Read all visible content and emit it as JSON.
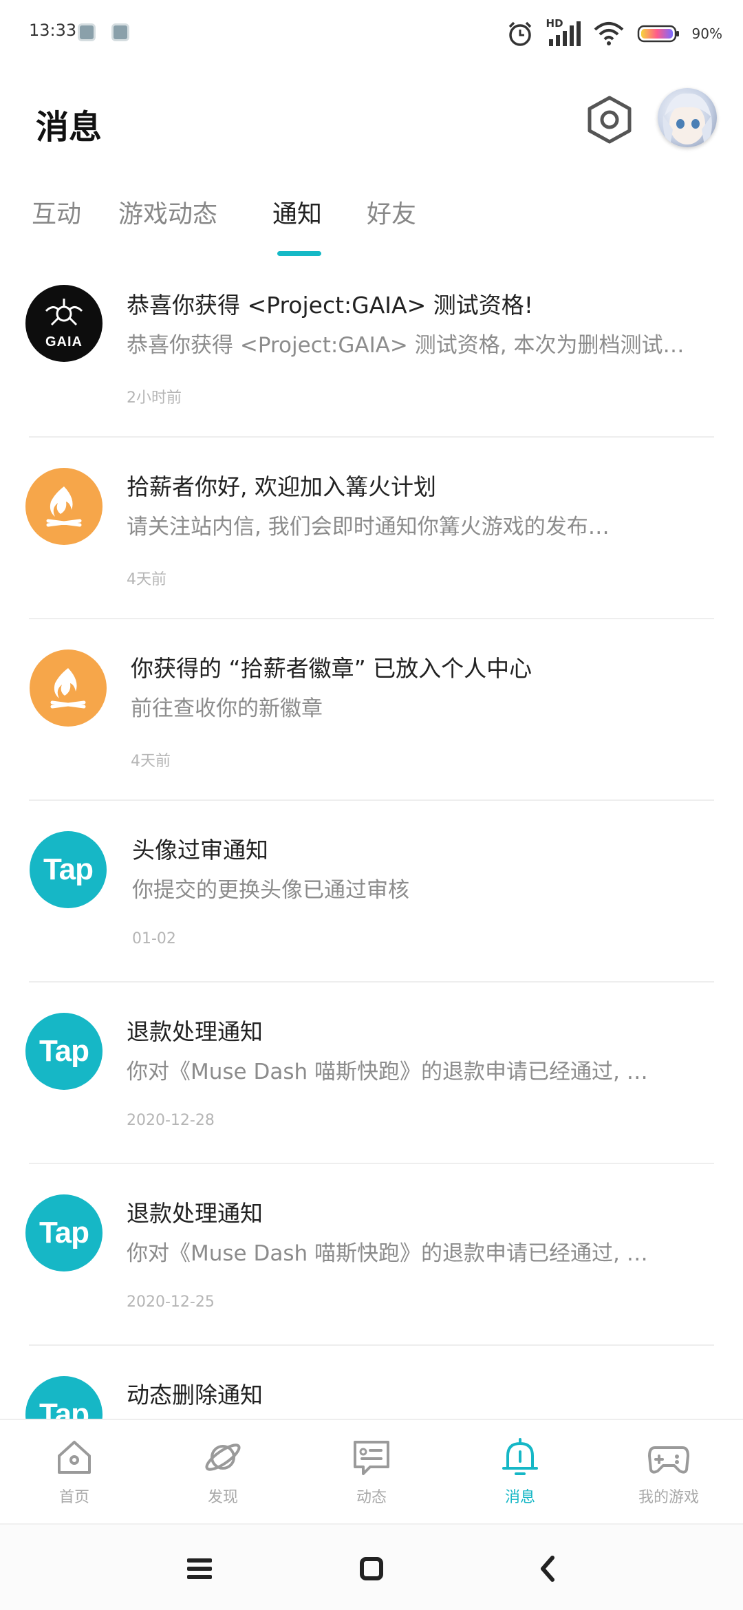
{
  "status_bar": {
    "time": "13:33",
    "network": "HD",
    "battery": "90%"
  },
  "header": {
    "title": "消息"
  },
  "tabs": [
    {
      "label": "互动"
    },
    {
      "label": "游戏动态"
    },
    {
      "label": "通知",
      "active": true
    },
    {
      "label": "好友"
    }
  ],
  "messages": [
    {
      "icon": "gaia-logo",
      "logo_text": "GAIA",
      "title": "恭喜你获得 <Project:GAIA> 测试资格!",
      "body": "恭喜你获得 <Project:GAIA> 测试资格, 本次为删档测试…",
      "time": "2小时前"
    },
    {
      "icon": "bonfire-icon",
      "title": "拾薪者你好, 欢迎加入篝火计划",
      "body": "请关注站内信, 我们会即时通知你篝火游戏的发布…",
      "time": "4天前"
    },
    {
      "icon": "bonfire-icon",
      "title": "你获得的 “拾薪者徽章” 已放入个人中心",
      "body": "前往查收你的新徽章",
      "time": "4天前"
    },
    {
      "icon": "tap-logo",
      "logo_text": "Tap",
      "title": "头像过审通知",
      "body": "你提交的更换头像已通过审核",
      "time": "01-02"
    },
    {
      "icon": "tap-logo",
      "logo_text": "Tap",
      "title": "退款处理通知",
      "body": "你对《Muse Dash 喵斯快跑》的退款申请已经通过, …",
      "time": "2020-12-28"
    },
    {
      "icon": "tap-logo",
      "logo_text": "Tap",
      "title": "退款处理通知",
      "body": "你对《Muse Dash 喵斯快跑》的退款申请已经通过, …",
      "time": "2020-12-25"
    },
    {
      "icon": "tap-logo",
      "logo_text": "Tap",
      "title": "动态删除通知",
      "body": "",
      "time": ""
    }
  ],
  "bottom_nav": [
    {
      "label": "首页",
      "icon": "home-icon"
    },
    {
      "label": "发现",
      "icon": "planet-icon"
    },
    {
      "label": "动态",
      "icon": "feed-icon"
    },
    {
      "label": "消息",
      "icon": "bell-icon",
      "active": true
    },
    {
      "label": "我的游戏",
      "icon": "gamepad-icon"
    }
  ],
  "colors": {
    "accent": "#16b7c6",
    "bonfire": "#f6a64a",
    "muted_text": "#8c8c8c"
  }
}
